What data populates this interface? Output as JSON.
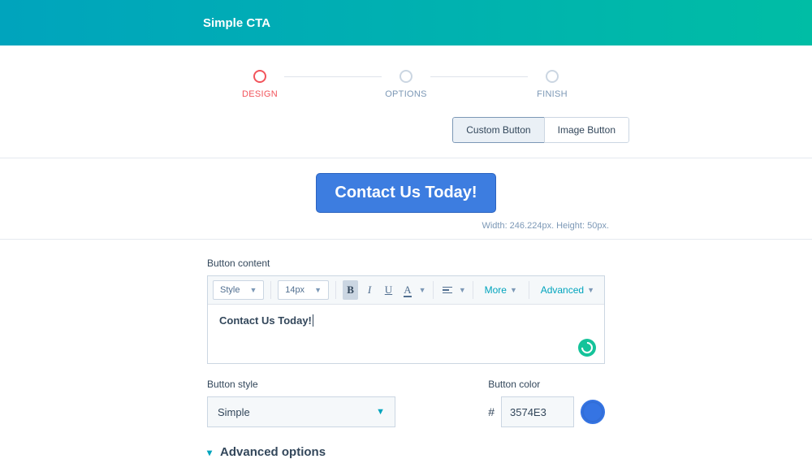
{
  "header": {
    "title": "Simple CTA"
  },
  "stepper": {
    "steps": [
      {
        "label": "DESIGN"
      },
      {
        "label": "OPTIONS"
      },
      {
        "label": "FINISH"
      }
    ]
  },
  "typeToggle": {
    "custom": "Custom Button",
    "image": "Image Button"
  },
  "preview": {
    "ctaText": "Contact Us Today!",
    "dims": "Width: 246.224px. Height: 50px."
  },
  "contentField": {
    "label": "Button content",
    "toolbar": {
      "style": "Style",
      "fontSize": "14px",
      "more": "More",
      "advanced": "Advanced"
    },
    "value": "Contact Us Today!"
  },
  "styleField": {
    "label": "Button style",
    "value": "Simple"
  },
  "colorField": {
    "label": "Button color",
    "value": "3574E3"
  },
  "advanced": {
    "label": "Advanced options"
  }
}
